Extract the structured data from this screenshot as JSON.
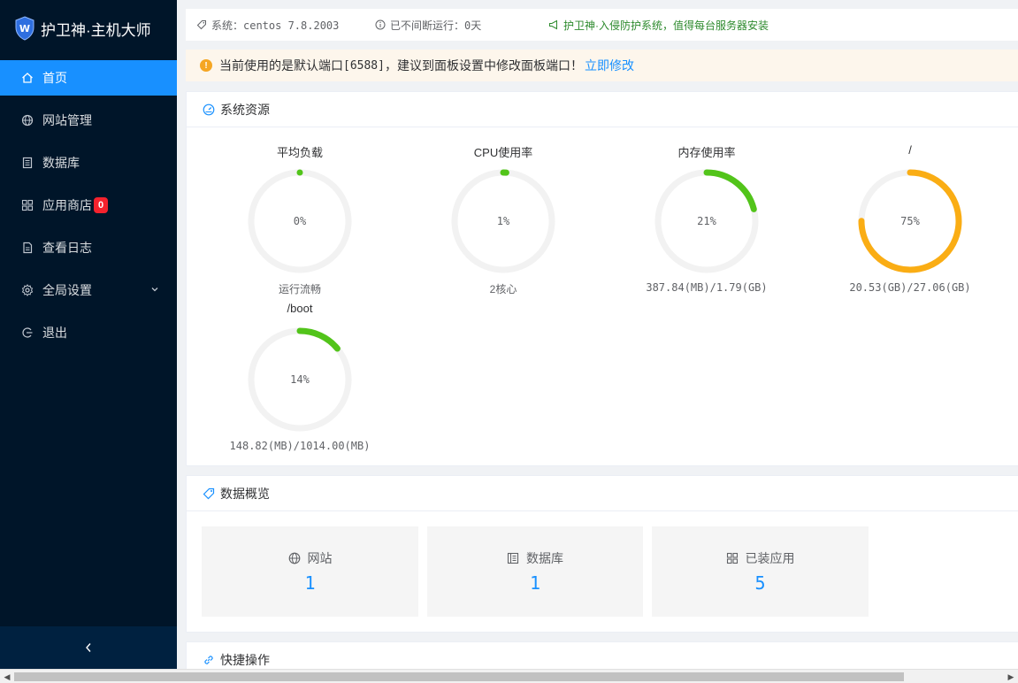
{
  "brand": {
    "title": "护卫神·主机大师"
  },
  "sidebar": {
    "items": [
      {
        "label": "首页",
        "icon": "home-icon",
        "active": true
      },
      {
        "label": "网站管理",
        "icon": "globe-icon"
      },
      {
        "label": "数据库",
        "icon": "database-icon"
      },
      {
        "label": "应用商店",
        "icon": "apps-icon",
        "badge": "0"
      },
      {
        "label": "查看日志",
        "icon": "log-icon"
      },
      {
        "label": "全局设置",
        "icon": "gear-icon",
        "has_submenu": true
      },
      {
        "label": "退出",
        "icon": "logout-icon"
      }
    ],
    "collapse_icon": "chevron-left-icon"
  },
  "topbar": {
    "system": "系统：centos 7.8.2003",
    "uptime": "已不间断运行：0天",
    "promo": "护卫神·入侵防护系统，值得每台服务器安装"
  },
  "notice": {
    "text_before": "当前使用的是默认端口",
    "port": "[6588]",
    "text_after": "，建议到面板设置中修改面板端口！",
    "link": "立即修改"
  },
  "resources": {
    "title": "系统资源",
    "gauges": [
      {
        "title": "平均负载",
        "value": "0%",
        "percent": 0,
        "sub": "运行流畅",
        "color": "#52c41a"
      },
      {
        "title": "CPU使用率",
        "value": "1%",
        "percent": 1,
        "sub": "2核心",
        "color": "#52c41a"
      },
      {
        "title": "内存使用率",
        "value": "21%",
        "percent": 21,
        "sub": "387.84(MB)/1.79(GB)",
        "color": "#52c41a"
      },
      {
        "title": "/",
        "value": "75%",
        "percent": 75,
        "sub": "20.53(GB)/27.06(GB)",
        "color": "#faad14"
      },
      {
        "title": "/boot",
        "value": "14%",
        "percent": 14,
        "sub": "148.82(MB)/1014.00(MB)",
        "color": "#52c41a"
      }
    ]
  },
  "overview": {
    "title": "数据概览",
    "items": [
      {
        "label": "网站",
        "value": "1",
        "icon": "globe-icon"
      },
      {
        "label": "数据库",
        "value": "1",
        "icon": "database-icon"
      },
      {
        "label": "已装应用",
        "value": "5",
        "icon": "apps-icon"
      }
    ]
  },
  "quick": {
    "title": "快捷操作"
  }
}
